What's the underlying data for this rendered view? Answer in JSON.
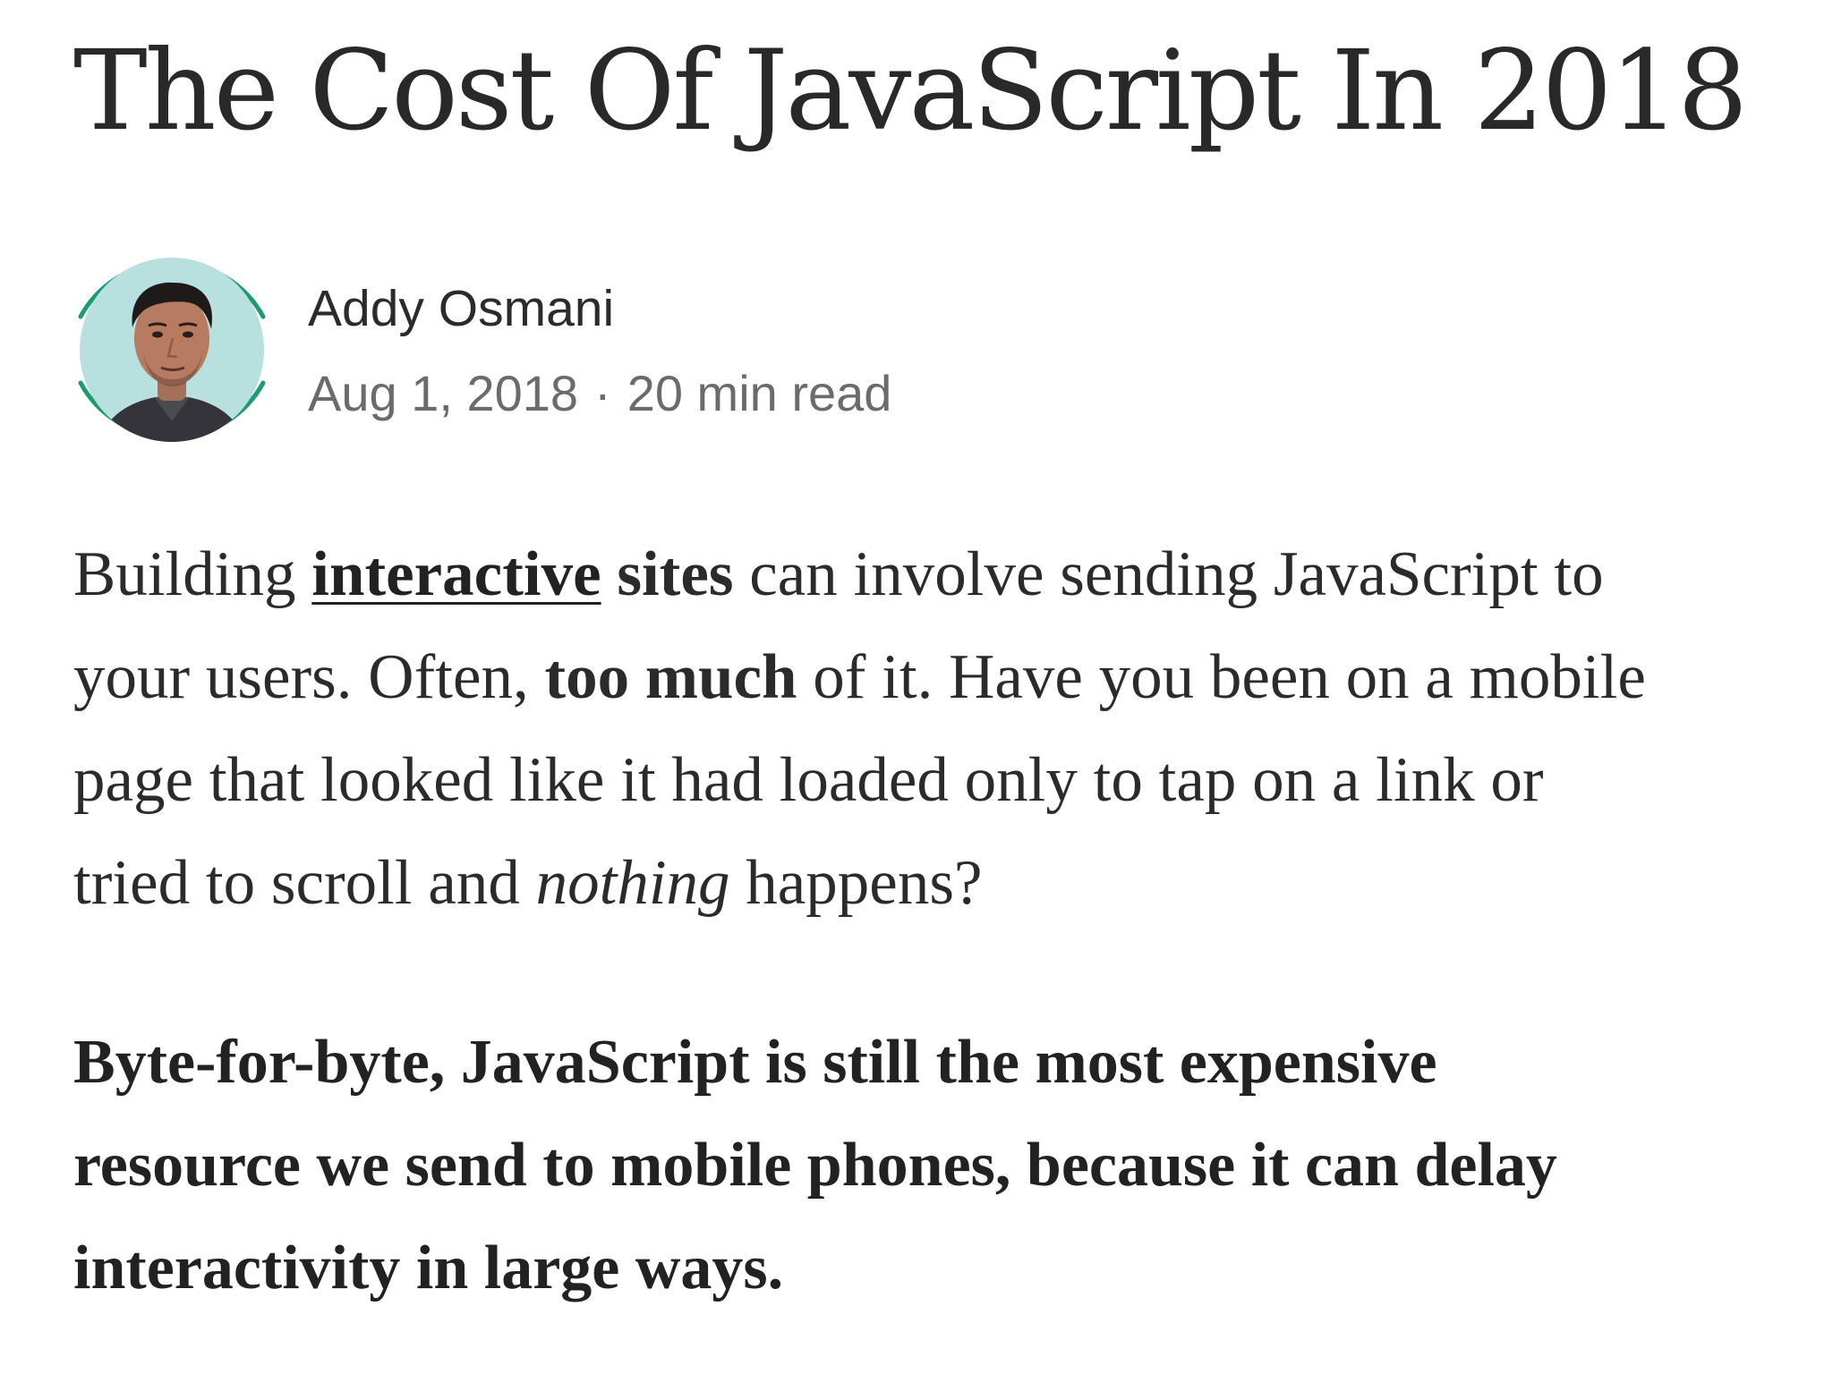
{
  "article": {
    "title": "The Cost Of JavaScript In 2018",
    "author": {
      "name": "Addy Osmani",
      "avatar_icon": "author-avatar",
      "ring_color": "#1a9c6f",
      "avatar_bg": "#b8e0df"
    },
    "meta": {
      "date": "Aug 1, 2018",
      "separator": "·",
      "read_time": "20 min read"
    },
    "paragraph1": {
      "l1_a": "Building ",
      "l1_link": "interactive",
      "l1_b": " ",
      "l1_bold": "sites",
      "l1_c": " can involve sending JavaScript to",
      "l2_a": "your users. Often, ",
      "l2_bold": "too much",
      "l2_b": " of it. Have you been on a mobile",
      "l3": "page that looked like it had loaded only to tap on a link or",
      "l4_a": "tried to scroll and ",
      "l4_italic": "nothing",
      "l4_b": " happens?"
    },
    "paragraph2": {
      "l1": "Byte-for-byte, JavaScript is still the most expensive",
      "l2": "resource we send to mobile phones, because it can delay",
      "l3": "interactivity in large ways."
    }
  }
}
